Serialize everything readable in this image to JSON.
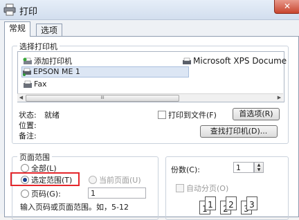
{
  "window": {
    "title": "打印",
    "close_label": "✕"
  },
  "tabs": [
    {
      "label": "常规"
    },
    {
      "label": "选项"
    }
  ],
  "printer_group": {
    "title": "选择打印机",
    "printers": [
      {
        "label": "添加打印机",
        "icon": "add-printer-icon"
      },
      {
        "label": "EPSON ME 1",
        "icon": "printer-icon",
        "selected": true
      },
      {
        "label": "Fax",
        "icon": "fax-icon"
      },
      {
        "label": "Microsoft XPS Docume",
        "icon": "printer-icon"
      }
    ],
    "scroll_thumb_grip": "III"
  },
  "status": {
    "status_label": "状态:",
    "status_value": "就绪",
    "location_label": "位置:",
    "comment_label": "备注:"
  },
  "options": {
    "print_to_file_label": "打印到文件(F)",
    "preferences_button": "首选项(R)",
    "find_printer_button": "查找打印机(D)..."
  },
  "page_range": {
    "title": "页面范围",
    "all_label": "全部(L)",
    "selection_label": "选定范围(T)",
    "current_page_label": "当前页面(U)",
    "pages_label": "页码(G):",
    "pages_value": "1",
    "hint": "输入页码或页面范围。如，5-12"
  },
  "copies": {
    "label": "份数(C):",
    "value": "1",
    "collate_label": "自动分页(O)",
    "collate_icons": [
      "1",
      "1",
      "2",
      "2",
      "3",
      "3"
    ]
  },
  "colors": {
    "highlight": "#e4262b",
    "selection": "#dce6f4"
  }
}
